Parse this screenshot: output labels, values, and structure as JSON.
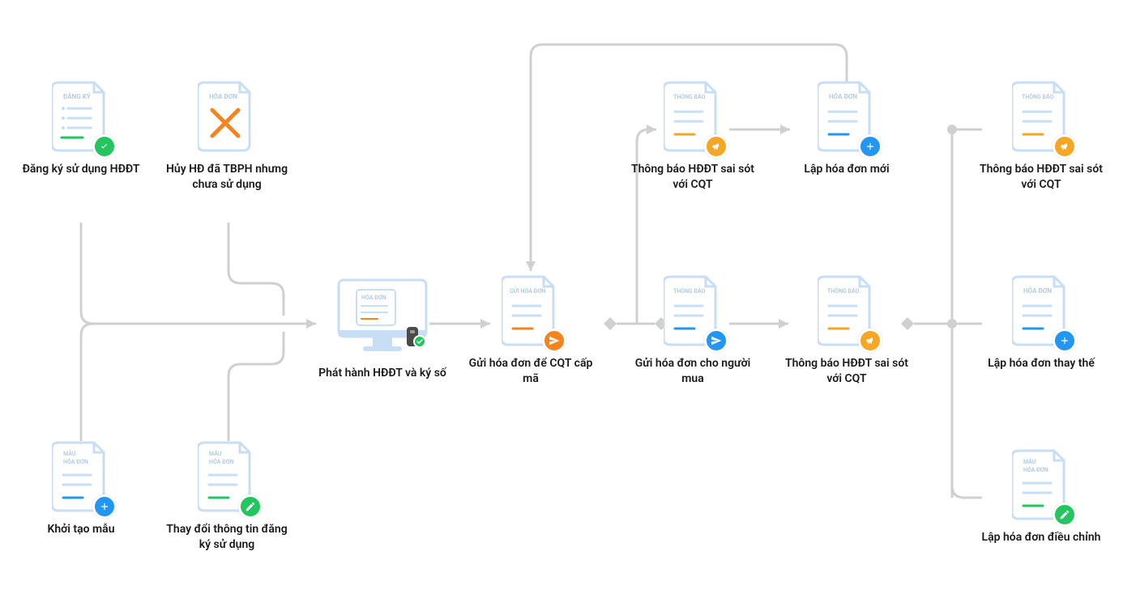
{
  "nodes": {
    "n1": {
      "title": "ĐĂNG KÝ",
      "label": "Đăng ký sử dụng HĐĐT"
    },
    "n2": {
      "title": "HÓA ĐƠN",
      "label": "Hủy HĐ đã TBPH nhưng chưa sử dụng"
    },
    "n3": {
      "title": "MẪU\nHÓA ĐƠN",
      "label": "Khởi tạo mẫu"
    },
    "n4": {
      "title": "MẪU\nHÓA ĐƠN",
      "label": "Thay đổi thông tin đăng ký sử dụng"
    },
    "n5": {
      "title": "HÓA ĐƠN",
      "label": "Phát hành HĐĐT và ký số"
    },
    "n6": {
      "title": "GỬI HÓA ĐƠN",
      "label": "Gửi hóa đơn để CQT cấp mã"
    },
    "n7": {
      "title": "THÔNG BÁO",
      "label": "Thông báo HĐĐT sai sót với CQT"
    },
    "n8": {
      "title": "HÓA ĐƠN",
      "label": "Lập hóa đơn mới"
    },
    "n9": {
      "title": "THÔNG BÁO",
      "label": "Gửi hóa đơn cho người mua"
    },
    "n10": {
      "title": "THÔNG BÁO",
      "label": "Thông báo HĐĐT sai sót với CQT"
    },
    "n11": {
      "title": "THÔNG BÁO",
      "label": "Thông báo HĐĐT sai sót với CQT"
    },
    "n12": {
      "title": "HÓA ĐƠN",
      "label": "Lập hóa đơn thay thế"
    },
    "n13": {
      "title": "MẪU\nHÓA ĐƠN",
      "label": "Lập hóa đơn điều chỉnh"
    }
  },
  "colors": {
    "docStroke": "#c7def5",
    "lineBlue": "#5fa8e8",
    "lineOrange": "#f5a623",
    "lineGreen": "#22c55e",
    "badgeGreen": "#22c55e",
    "badgeBlue": "#2196f3",
    "badgeOrange": "#f5a623",
    "badgeOrangeDark": "#f5841f",
    "titleText": "#b3cce0"
  }
}
